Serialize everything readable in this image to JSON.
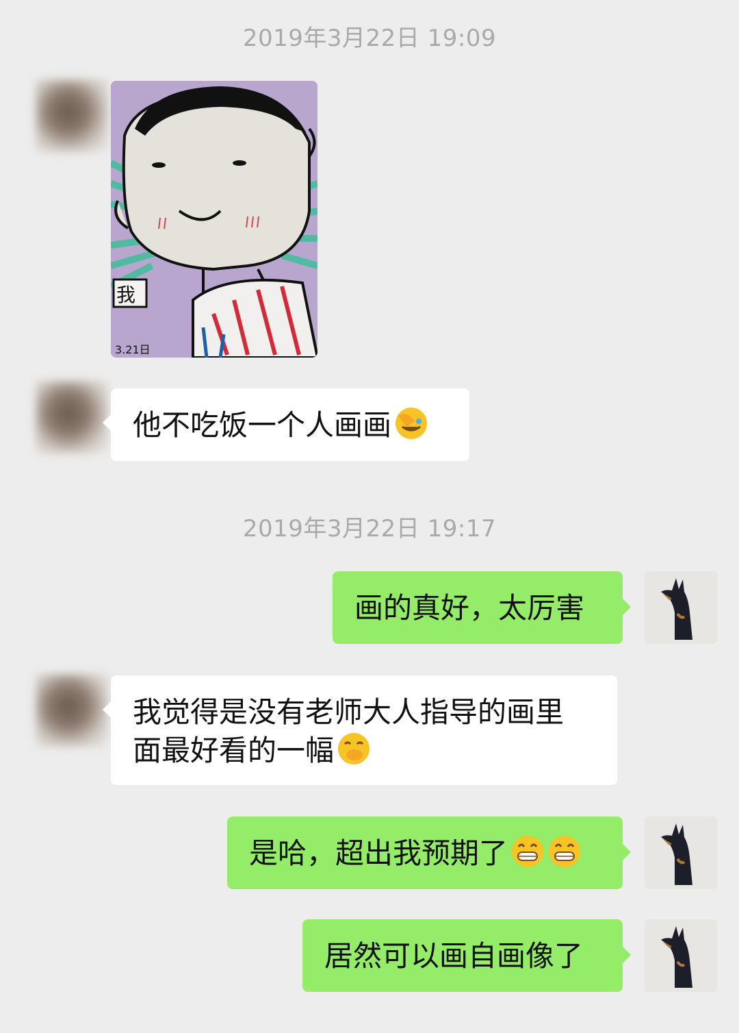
{
  "chat": {
    "timestamps": [
      "2019年3月22日 19:09",
      "2019年3月22日 19:17"
    ],
    "messages": [
      {
        "side": "in",
        "type": "image",
        "description_label": "我",
        "signature_date": "3.21日"
      },
      {
        "side": "in",
        "text": "他不吃饭一个人画画",
        "emoji": "facepalm-laugh"
      },
      {
        "side": "out",
        "text": "画的真好，太厉害"
      },
      {
        "side": "in",
        "text_line1": "我觉得是没有老师大人指导的画里",
        "text_line2": "面最好看的一幅",
        "emoji": "hand-over-mouth"
      },
      {
        "side": "out",
        "text": "是哈，超出我预期了",
        "emoji": "grin",
        "emoji_count": 2
      },
      {
        "side": "out",
        "text": "居然可以画自画像了"
      }
    ]
  },
  "colors": {
    "background": "#ededed",
    "incoming_bubble": "#ffffff",
    "outgoing_bubble": "#95ec69",
    "timestamp_text": "#a9a9a9"
  }
}
